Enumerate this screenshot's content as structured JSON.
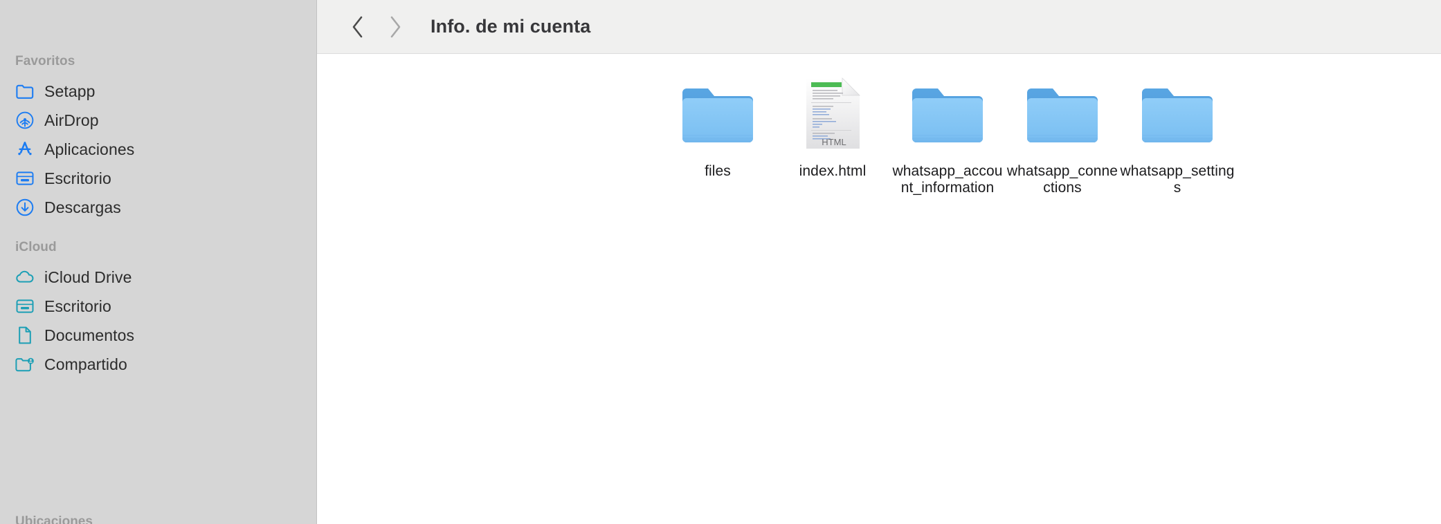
{
  "window": {
    "title": "Info. de mi cuenta"
  },
  "toolbar": {
    "back_label": "‹",
    "forward_label": "›",
    "title": "Info. de mi cuenta"
  },
  "colors": {
    "sidebar_bg": "#d6d6d6",
    "toolbar_bg": "#f0f0ef",
    "content_bg": "#ffffff",
    "favorites_icon": "#1c7cf2",
    "icloud_icon": "#1c9fb5",
    "folder_front": "#86c6f4",
    "folder_back": "#54a0dd",
    "header_text": "#9a9a9a",
    "label_text": "#2c2c2c",
    "html_badge": "#4cbb54"
  },
  "sidebar": {
    "groups": [
      {
        "header": "Favoritos",
        "items": [
          {
            "label": "Setapp",
            "icon": "folder-icon"
          },
          {
            "label": "AirDrop",
            "icon": "airdrop-icon"
          },
          {
            "label": "Aplicaciones",
            "icon": "applications-icon"
          },
          {
            "label": "Escritorio",
            "icon": "desktop-icon"
          },
          {
            "label": "Descargas",
            "icon": "downloads-icon"
          }
        ]
      },
      {
        "header": "iCloud",
        "items": [
          {
            "label": "iCloud Drive",
            "icon": "cloud-icon"
          },
          {
            "label": "Escritorio",
            "icon": "desktop-icon"
          },
          {
            "label": "Documentos",
            "icon": "document-icon"
          },
          {
            "label": "Compartido",
            "icon": "shared-folder-icon"
          }
        ]
      }
    ],
    "bottom_header": "Ubicaciones"
  },
  "files": {
    "items": [
      {
        "name": "files",
        "type": "folder"
      },
      {
        "name": "index.html",
        "type": "html",
        "badge": "HTML"
      },
      {
        "name": "whatsapp_account_information",
        "type": "folder"
      },
      {
        "name": "whatsapp_connections",
        "type": "folder"
      },
      {
        "name": "whatsapp_settings",
        "type": "folder"
      }
    ]
  }
}
